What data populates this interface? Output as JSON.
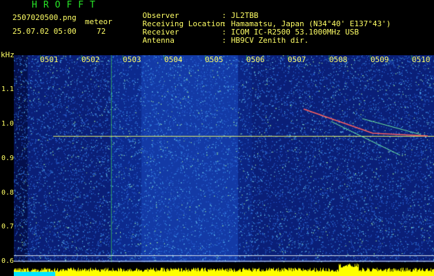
{
  "app": {
    "title": "HROFFT"
  },
  "file": {
    "name": "2507020500.png",
    "timestamp": "25.07.02 05:00"
  },
  "detection": {
    "mode": "meteor",
    "count": "72"
  },
  "station": [
    {
      "key": "Observer",
      "value": ": JL2TBB"
    },
    {
      "key": "Receiving Location",
      "value": ": Hamamatsu, Japan (N34°40' E137°43')"
    },
    {
      "key": "Receiver",
      "value": ": ICOM IC-R2500 53.1000MHz USB"
    },
    {
      "key": "Antenna",
      "value": ": HB9CV Zenith dir."
    }
  ],
  "axis": {
    "unit": "kHz",
    "y_ticks": [
      "1.1",
      "1.0",
      "0.9",
      "0.8",
      "0.7",
      "0.6"
    ],
    "x_ticks": [
      "0501",
      "0502",
      "0503",
      "0504",
      "0505",
      "0506",
      "0507",
      "0508",
      "0509",
      "0510"
    ]
  },
  "colors": {
    "background": "#000000",
    "noise_dark": "#10248c",
    "noise_light": "#2a6ad8",
    "carrier_line": "#e6f06a",
    "header_text": "#ffff66",
    "title_text": "#27e627",
    "grid": "#2bd22b",
    "power_bar": "#ffff00",
    "power_base": "#00e5ff"
  }
}
